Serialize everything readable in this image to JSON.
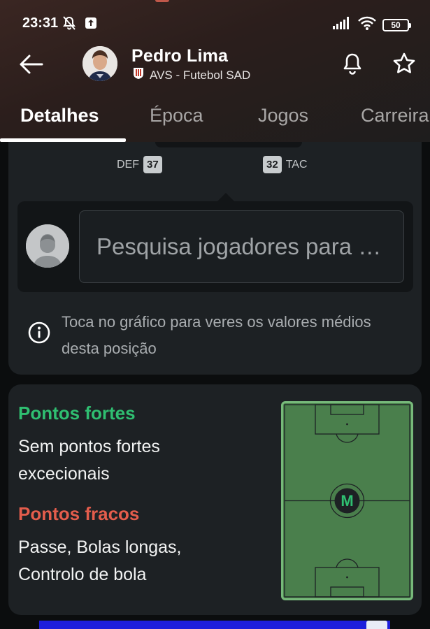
{
  "status_bar": {
    "time": "23:31",
    "battery": "50",
    "icons": [
      "mute-icon",
      "upload-icon",
      "signal-icon",
      "wifi-icon",
      "battery-icon"
    ]
  },
  "header": {
    "player_name": "Pedro Lima",
    "team": "AVS - Futebol SAD",
    "icons": [
      "back-arrow-icon",
      "bell-icon",
      "star-icon"
    ]
  },
  "tabs": [
    {
      "label": "Detalhes",
      "active": true
    },
    {
      "label": "Época",
      "active": false
    },
    {
      "label": "Jogos",
      "active": false
    },
    {
      "label": "Carreira",
      "active": false
    }
  ],
  "attributes_chart": {
    "def": {
      "label": "DEF",
      "value": "37"
    },
    "tac": {
      "label": "TAC",
      "value": "32"
    }
  },
  "compare": {
    "placeholder": "Pesquisa jogadores para comparar"
  },
  "info": {
    "text": "Toca no gráfico para veres os valores médios desta posição"
  },
  "strengths": {
    "strong_title": "Pontos fortes",
    "strong_text": "Sem pontos fortes excecionais",
    "weak_title": "Pontos fracos",
    "weak_text": "Passe, Bolas longas, Controlo de bola"
  },
  "position": {
    "label": "M"
  },
  "colors": {
    "strong": "#2fbf71",
    "weak": "#e45d4c",
    "pitch": "#4a7f4c",
    "card": "#1d2124"
  }
}
